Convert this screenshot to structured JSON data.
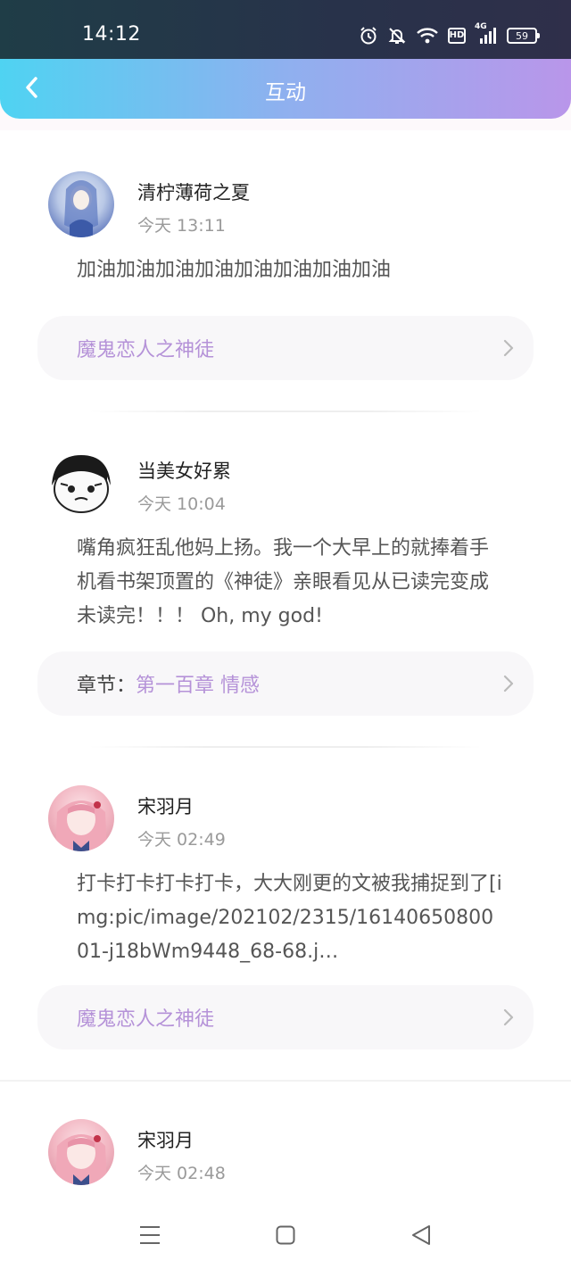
{
  "status_bar": {
    "time": "14:12",
    "battery_level": "59",
    "network": "4G",
    "hd": "HD"
  },
  "header": {
    "title": "互动"
  },
  "posts": [
    {
      "user": "清柠薄荷之夏",
      "time": "今天 13:11",
      "text": "加油加油加油加油加油加油加油加油",
      "link": {
        "prefix": "",
        "text": "魔鬼恋人之神徒"
      }
    },
    {
      "user": "当美女好累",
      "time": "今天 10:04",
      "text": "嘴角疯狂乱他妈上扬。我一个大早上的就捧着手机看书架顶置的《神徒》亲眼看见从已读完变成未读完！！！ Oh, my god!",
      "link": {
        "prefix": "章节：",
        "text": "第一百章 情感"
      }
    },
    {
      "user": "宋羽月",
      "time": "今天 02:49",
      "text": "打卡打卡打卡打卡，大大刚更的文被我捕捉到了[img:pic/image/202102/2315/1614065080001-j18bWm9448_68-68.j…",
      "link": {
        "prefix": "",
        "text": "魔鬼恋人之神徒"
      }
    },
    {
      "user": "宋羽月",
      "time": "今天 02:48"
    }
  ],
  "colors": {
    "accent_link": "#b592d8",
    "header_start": "#4fd3f2",
    "header_end": "#b996ea"
  },
  "icons": [
    "back-chevron-icon",
    "alarm-icon",
    "mute-icon",
    "wifi-icon",
    "signal-icon",
    "battery-icon",
    "menu-icon",
    "home-icon",
    "back-icon",
    "chevron-right-icon"
  ]
}
